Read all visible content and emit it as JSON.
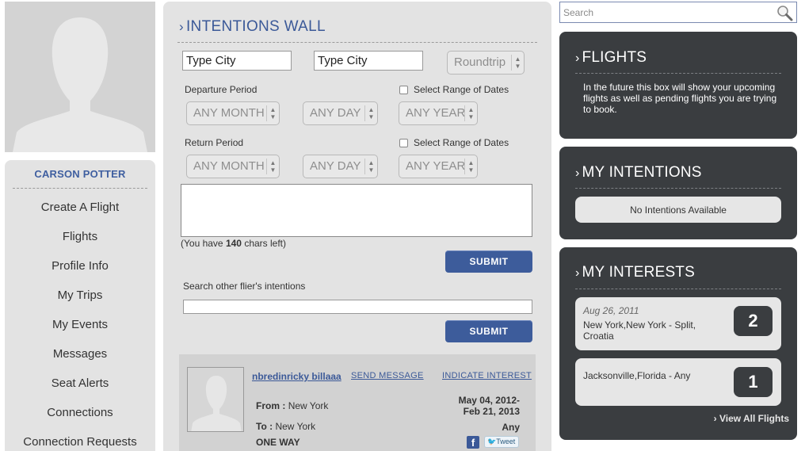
{
  "profile": {
    "name": "CARSON POTTER",
    "nav": [
      "Create A Flight",
      "Flights",
      "Profile Info",
      "My Trips",
      "My Events",
      "Messages",
      "Seat Alerts",
      "Connections",
      "Connection Requests"
    ]
  },
  "wall": {
    "title": "INTENTIONS WALL",
    "from_placeholder": "Type City",
    "to_placeholder": "Type City",
    "trip_type": "Roundtrip",
    "departure_label": "Departure Period",
    "return_label": "Return Period",
    "range_label": "Select Range of Dates",
    "month": "ANY MONTH",
    "day": "ANY DAY",
    "year": "ANY YEAR",
    "chars_prefix": "(You have",
    "chars_count": "140",
    "chars_suffix": "chars left)",
    "submit_label": "SUBMIT",
    "search_label": "Search other flier's intentions",
    "search_submit_label": "SUBMIT"
  },
  "intention": {
    "user": "nbredinricky billaaa",
    "send_message": "SEND MESSAGE",
    "indicate_interest": "INDICATE INTEREST",
    "from_label": "From :",
    "from_value": "New York",
    "to_label": "To :",
    "to_value": "New York",
    "trip": "ONE WAY",
    "date_start": "May 04, 2012-",
    "date_end": "Feb 21, 2013",
    "any": "Any",
    "facebook_icon": "f",
    "tweet_label": "Tweet"
  },
  "search": {
    "placeholder": "Search"
  },
  "flights": {
    "title": "FLIGHTS",
    "text": "In the future this box will show your upcoming flights as well as pending flights you are trying to book."
  },
  "my_intentions": {
    "title": "MY INTENTIONS",
    "empty": "No Intentions Available"
  },
  "my_interests": {
    "title": "MY INTERESTS",
    "items": [
      {
        "date": "Aug 26, 2011",
        "route": "New York,New York - Split, Croatia",
        "count": "2"
      },
      {
        "date": "",
        "route": "Jacksonville,Florida - Any",
        "count": "1"
      }
    ],
    "view_all": "› View All Flights"
  },
  "chevron": "›"
}
